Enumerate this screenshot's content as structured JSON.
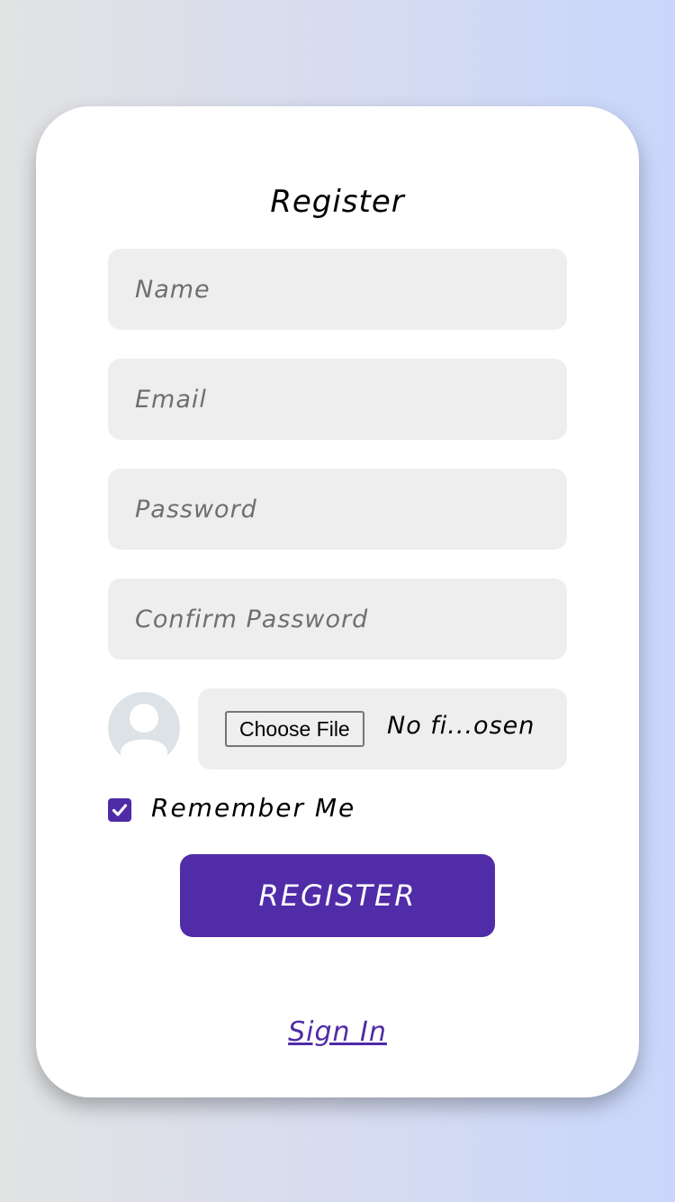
{
  "form": {
    "title": "Register",
    "name_placeholder": "Name",
    "email_placeholder": "Email",
    "password_placeholder": "Password",
    "confirm_password_placeholder": "Confirm Password",
    "avatar_icon": "user-avatar-icon",
    "file_button_label": "Choose File",
    "file_status": "No fi...osen",
    "remember_me_label": "Remember Me",
    "remember_me_checked": true,
    "submit_label": "REGISTER",
    "signin_link": "Sign In"
  },
  "colors": {
    "accent": "#502ca8",
    "field_background": "#eeeeee",
    "card_background": "#ffffff",
    "background_left": "#e2e3e3",
    "background_right": "#c9d6fb"
  }
}
